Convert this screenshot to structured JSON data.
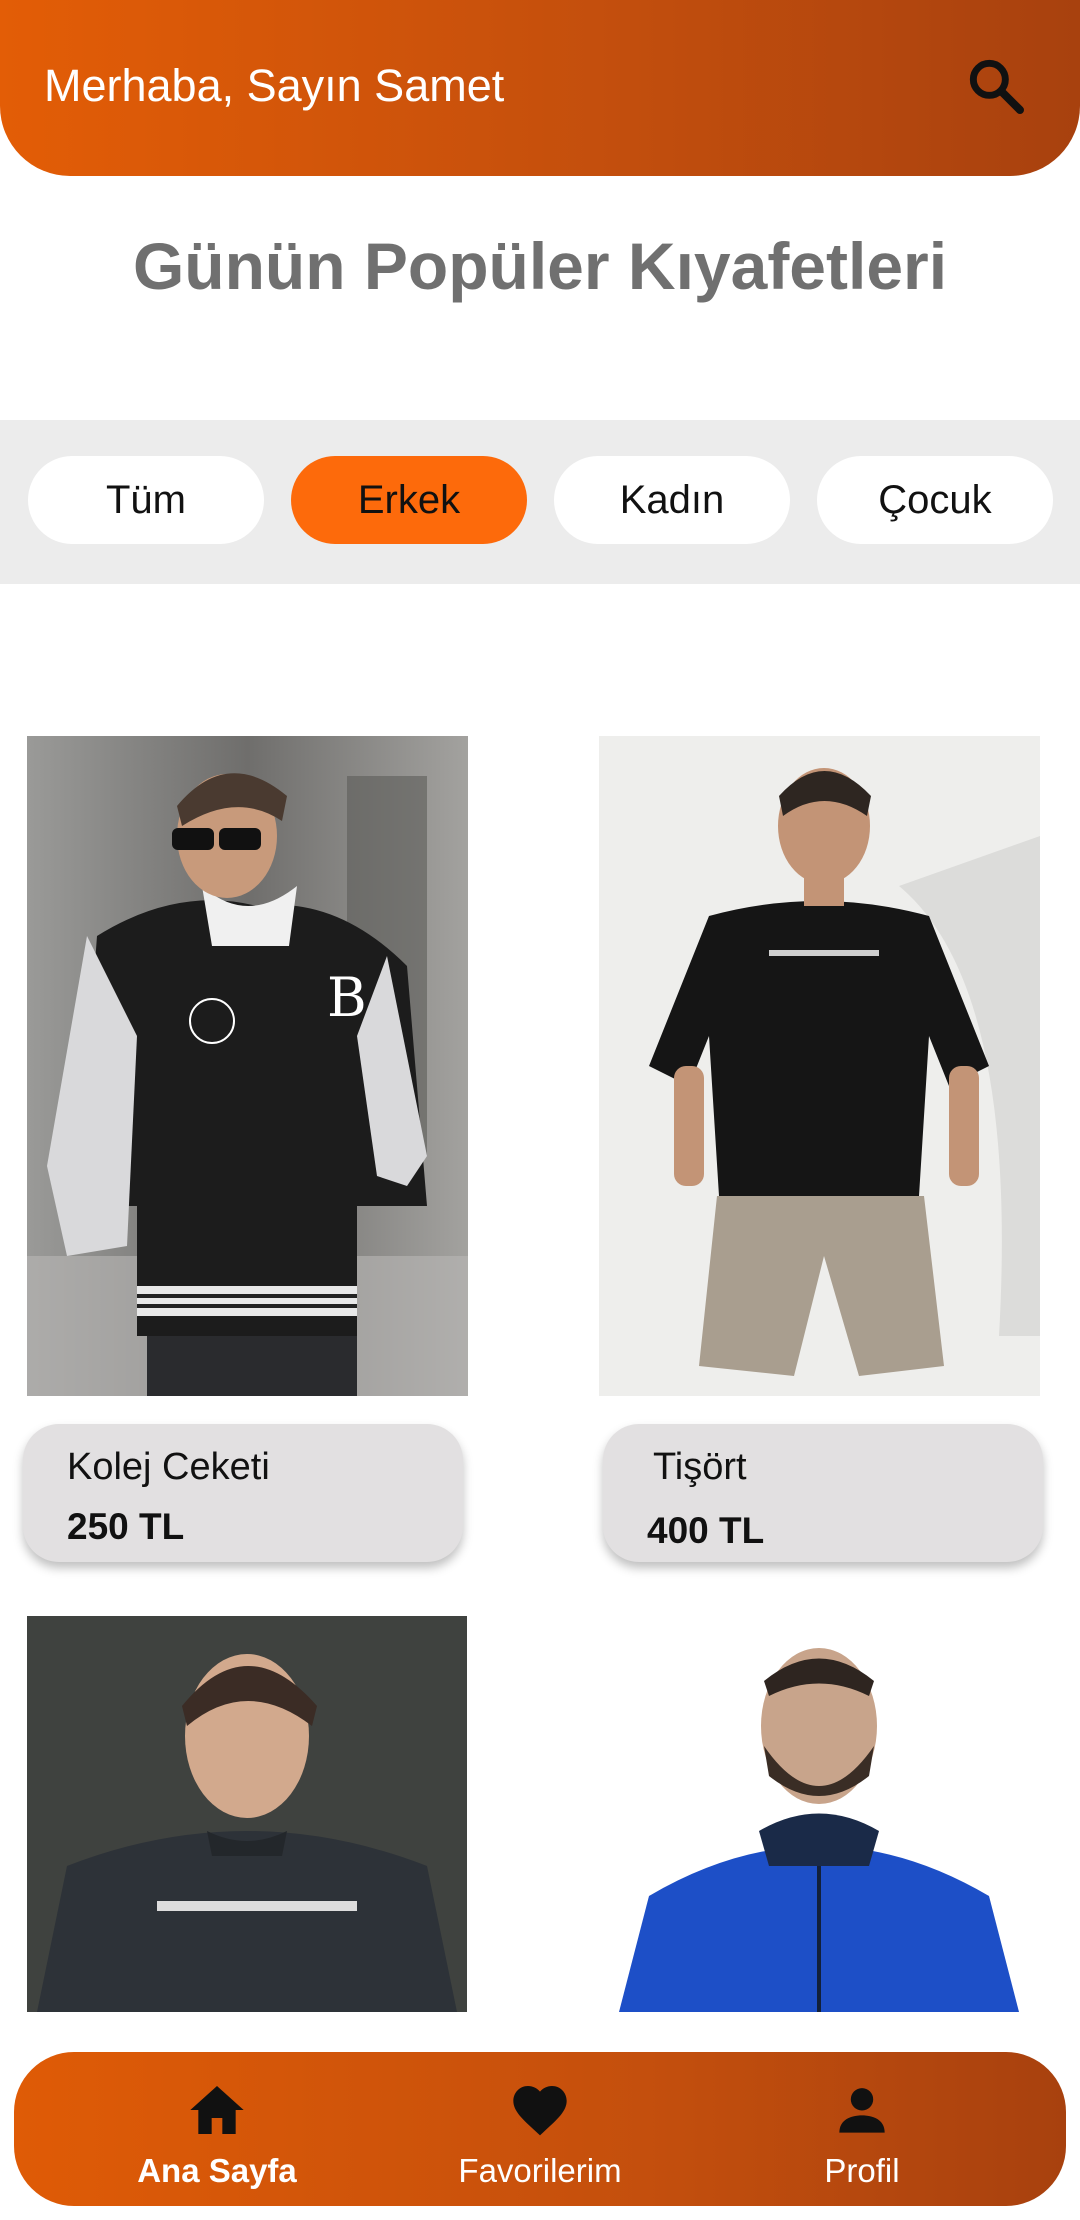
{
  "header": {
    "greeting": "Merhaba, Sayın Samet",
    "search_icon": "search-icon"
  },
  "page_title": "Günün Popüler Kıyafetleri",
  "filters": [
    {
      "label": "Tüm",
      "active": false
    },
    {
      "label": "Erkek",
      "active": true
    },
    {
      "label": "Kadın",
      "active": false
    },
    {
      "label": "Çocuk",
      "active": false
    }
  ],
  "products": [
    {
      "name": "Kolej Ceketi",
      "price": "250 TL"
    },
    {
      "name": "Tişört",
      "price": "400 TL"
    },
    {
      "name": "",
      "price": ""
    },
    {
      "name": "",
      "price": ""
    }
  ],
  "bottom_nav": [
    {
      "label": "Ana Sayfa",
      "icon": "home-icon",
      "active": true
    },
    {
      "label": "Favorilerim",
      "icon": "heart-icon",
      "active": false
    },
    {
      "label": "Profil",
      "icon": "person-icon",
      "active": false
    }
  ],
  "colors": {
    "accent": "#fd6a0b",
    "header_gradient_start": "#e35d06",
    "header_gradient_end": "#a8410e",
    "card_bg": "#e2e0e1",
    "filter_bar_bg": "#ececec",
    "title_gray": "#707070"
  }
}
